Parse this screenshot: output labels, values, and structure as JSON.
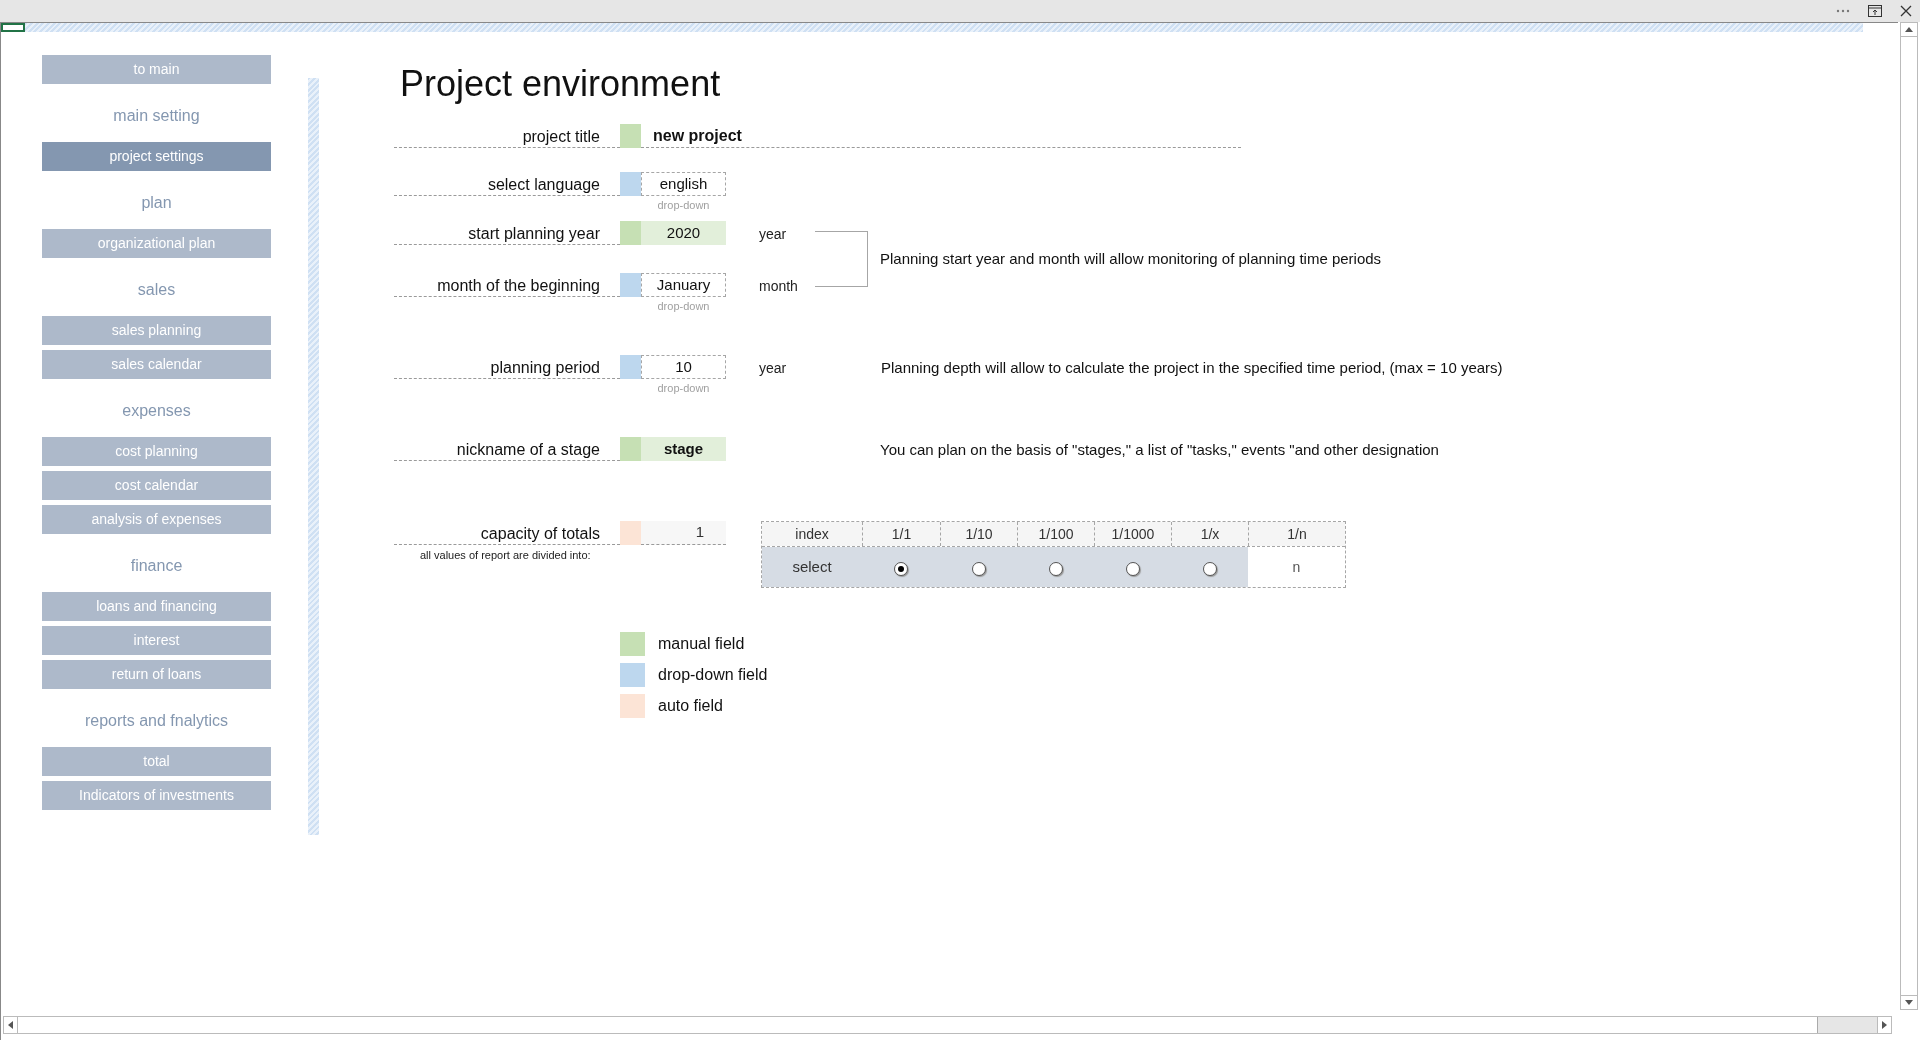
{
  "sidebar": [
    {
      "kind": "button",
      "label": "to main",
      "selected": false
    },
    {
      "kind": "heading",
      "label": "main setting"
    },
    {
      "kind": "button",
      "label": "project settings",
      "selected": true
    },
    {
      "kind": "heading",
      "label": "plan"
    },
    {
      "kind": "button",
      "label": "organizational plan",
      "selected": false
    },
    {
      "kind": "heading",
      "label": "sales"
    },
    {
      "kind": "button",
      "label": "sales planning",
      "selected": false
    },
    {
      "kind": "button",
      "label": "sales calendar",
      "selected": false
    },
    {
      "kind": "heading",
      "label": "expenses"
    },
    {
      "kind": "button",
      "label": "cost planning",
      "selected": false
    },
    {
      "kind": "button",
      "label": "cost calendar",
      "selected": false
    },
    {
      "kind": "button",
      "label": "analysis of expenses",
      "selected": false
    },
    {
      "kind": "heading",
      "label": "finance"
    },
    {
      "kind": "button",
      "label": "loans and financing",
      "selected": false
    },
    {
      "kind": "button",
      "label": "interest",
      "selected": false
    },
    {
      "kind": "button",
      "label": "return of loans",
      "selected": false
    },
    {
      "kind": "heading",
      "label": "reports and fnalytics"
    },
    {
      "kind": "button",
      "label": "total",
      "selected": false
    },
    {
      "kind": "button",
      "label": "Indicators of investments",
      "selected": false
    }
  ],
  "title": "Project environment",
  "project_title": {
    "label": "project title",
    "kind": "manual",
    "value": "new project"
  },
  "language": {
    "label": "select language",
    "kind": "dropdown",
    "value": "english",
    "hint": "drop-down"
  },
  "planning_start": {
    "fields": [
      {
        "label": "start planning year",
        "kind": "manual",
        "value": "2020",
        "unit": "year"
      },
      {
        "label": "month of the beginning",
        "kind": "dropdown",
        "value": "January",
        "unit": "month",
        "hint": "drop-down"
      }
    ],
    "note": "Planning start year and month will allow monitoring of planning time periods"
  },
  "planning_period": {
    "label": "planning period",
    "kind": "dropdown",
    "value": "10",
    "hint": "drop-down",
    "unit": "year",
    "note": "Planning depth will allow to calculate the project in the specified time period, (max = 10 years)"
  },
  "stage_nickname": {
    "label": "nickname of a stage",
    "kind": "manual",
    "value": "stage",
    "note": "You can plan on the basis of \"stages,\" a list of \"tasks,\" events \"and other designation"
  },
  "capacity": {
    "label": "capacity of totals",
    "kind": "auto",
    "value": "1",
    "caption": "all values of report are divided into:"
  },
  "divisor_table": {
    "header": [
      "index",
      "1/1",
      "1/10",
      "1/100",
      "1/1000",
      "1/x",
      "1/n"
    ],
    "row_label": "select",
    "options": [
      {
        "selected": true
      },
      {
        "selected": false
      },
      {
        "selected": false
      },
      {
        "selected": false
      },
      {
        "selected": false
      }
    ],
    "custom": "n"
  },
  "legend": [
    {
      "kind": "manual",
      "label": "manual field"
    },
    {
      "kind": "dropdown",
      "label": "drop-down field"
    },
    {
      "kind": "auto",
      "label": "auto field"
    }
  ]
}
